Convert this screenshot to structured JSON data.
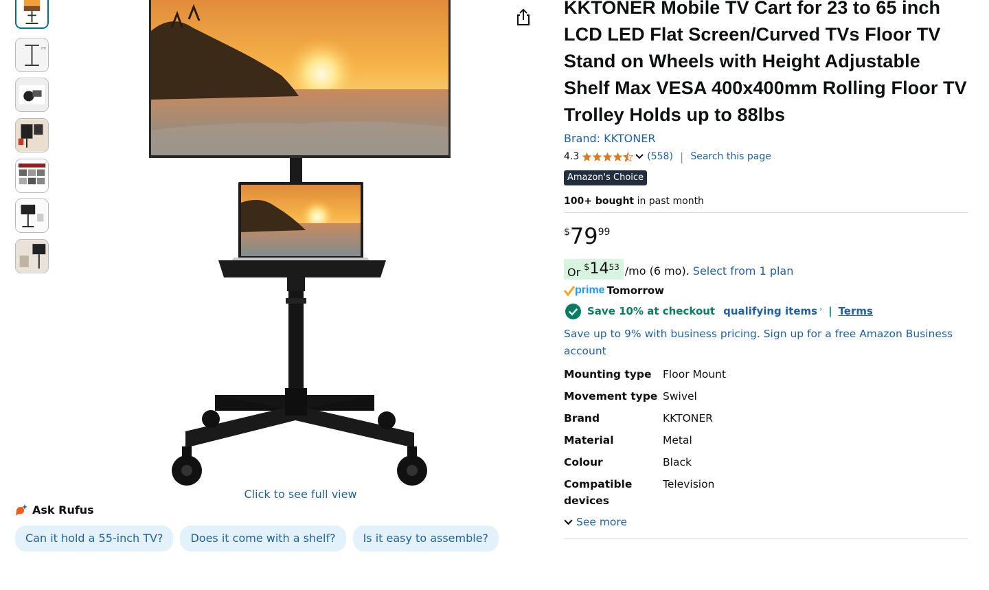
{
  "gallery": {
    "thumbnails": [
      "tv-cart-front",
      "tv-cart-dimensions",
      "tv-mount-closeup",
      "tv-cart-in-room",
      "tv-cart-features",
      "tv-cart-side",
      "tv-cart-living-room"
    ],
    "full_view_link": "Click to see full view"
  },
  "rufus": {
    "title": "Ask Rufus",
    "questions": [
      "Can it hold a 55-inch TV?",
      "Does it come with a shelf?",
      "Is it easy to assemble?"
    ]
  },
  "product": {
    "title": "KKTONER Mobile TV Cart for 23 to 65 inch LCD LED Flat Screen/Curved TVs Floor TV Stand on Wheels with Height Adjustable Shelf Max VESA 400x400mm Rolling Floor TV Trolley Holds up to 88lbs",
    "brand_link": "Brand: KKTONER",
    "rating": "4.3",
    "rating_count": "(558)",
    "separator": "|",
    "search_page": "Search this page",
    "badge": "Amazon's Choice",
    "bought_bold": "100+ bought",
    "bought_rest": " in past month"
  },
  "price": {
    "symbol": "$",
    "whole": "79",
    "fraction": "99"
  },
  "installment": {
    "or": "Or",
    "symbol": "$",
    "whole": "14",
    "fraction": "53",
    "per_month": "/mo (6 mo).",
    "plan_link": "Select from 1 plan"
  },
  "delivery": {
    "prime": "prime",
    "day": "Tomorrow"
  },
  "promo": {
    "save_text": "Save 10% at checkout",
    "qualifying": "qualifying items",
    "chevron": "›",
    "bar": "|",
    "terms": "Terms"
  },
  "business": "Save up to 9% with business pricing. Sign up for a free Amazon Business account",
  "specs": [
    {
      "label": "Mounting type",
      "value": "Floor Mount"
    },
    {
      "label": "Movement type",
      "value": "Swivel"
    },
    {
      "label": "Brand",
      "value": "KKTONER"
    },
    {
      "label": "Material",
      "value": "Metal"
    },
    {
      "label": "Colour",
      "value": "Black"
    },
    {
      "label": "Compatible devices",
      "value": "Television"
    }
  ],
  "see_more": "See more",
  "colors": {
    "link": "#2162a1",
    "deal_green": "#067d62",
    "star": "#de7921",
    "badge_bg": "#232f3e",
    "installment_bg": "#d7f4e0",
    "chip_bg": "#e3f1fb"
  }
}
